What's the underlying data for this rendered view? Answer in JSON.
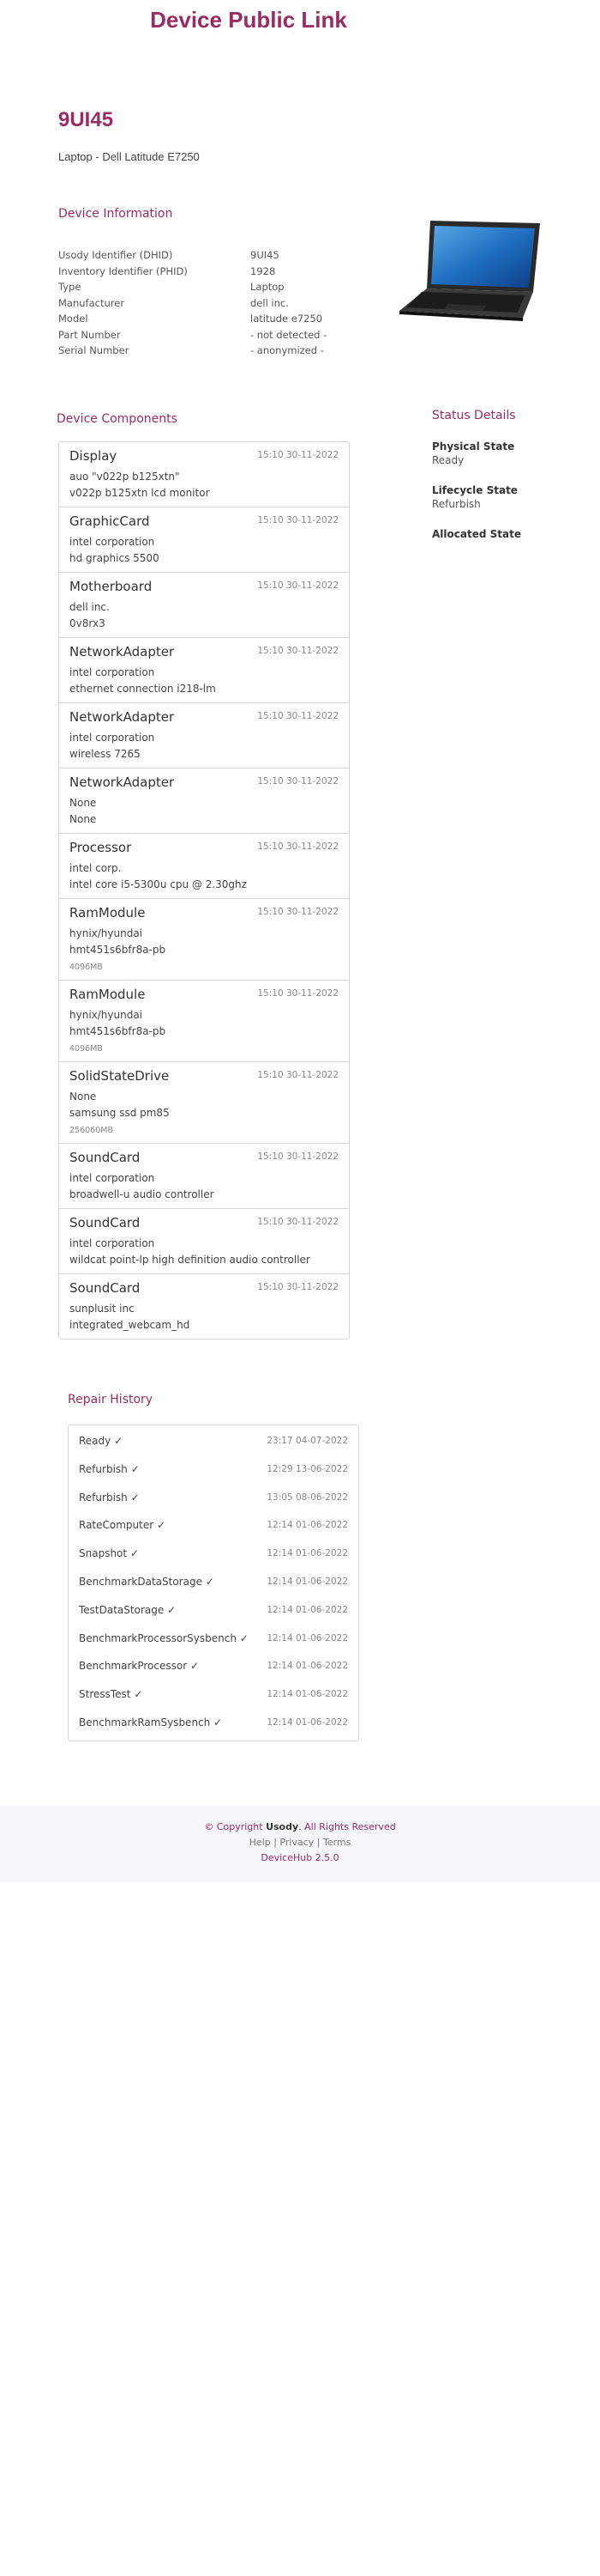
{
  "header": {
    "title": "Device Public Link"
  },
  "device": {
    "code": "9UI45",
    "subtitle": "Laptop - Dell Latitude E7250"
  },
  "info": {
    "heading": "Device Information",
    "rows": [
      {
        "label": "Usody Identifier (DHID)",
        "value": "9UI45"
      },
      {
        "label": "Inventory Identifier (PHID)",
        "value": "1928"
      },
      {
        "label": "Type",
        "value": "Laptop"
      },
      {
        "label": "Manufacturer",
        "value": "dell inc."
      },
      {
        "label": "Model",
        "value": "latitude e7250"
      },
      {
        "label": "Part Number",
        "value": "- not detected -"
      },
      {
        "label": "Serial Number",
        "value": "- anonymized -"
      }
    ]
  },
  "components": {
    "heading": "Device Components",
    "items": [
      {
        "type": "Display",
        "time": "15:10 30-11-2022",
        "line1": "auo \"v022p b125xtn\"",
        "line2": "v022p b125xtn lcd monitor",
        "size": ""
      },
      {
        "type": "GraphicCard",
        "time": "15:10 30-11-2022",
        "line1": "intel corporation",
        "line2": "hd graphics 5500",
        "size": ""
      },
      {
        "type": "Motherboard",
        "time": "15:10 30-11-2022",
        "line1": "dell inc.",
        "line2": "0v8rx3",
        "size": ""
      },
      {
        "type": "NetworkAdapter",
        "time": "15:10 30-11-2022",
        "line1": "intel corporation",
        "line2": "ethernet connection i218-lm",
        "size": ""
      },
      {
        "type": "NetworkAdapter",
        "time": "15:10 30-11-2022",
        "line1": "intel corporation",
        "line2": "wireless 7265",
        "size": ""
      },
      {
        "type": "NetworkAdapter",
        "time": "15:10 30-11-2022",
        "line1": "None",
        "line2": "None",
        "size": ""
      },
      {
        "type": "Processor",
        "time": "15:10 30-11-2022",
        "line1": "intel corp.",
        "line2": "intel core i5-5300u cpu @ 2.30ghz",
        "size": ""
      },
      {
        "type": "RamModule",
        "time": "15:10 30-11-2022",
        "line1": "hynix/hyundai",
        "line2": "hmt451s6bfr8a-pb",
        "size": "4096MB"
      },
      {
        "type": "RamModule",
        "time": "15:10 30-11-2022",
        "line1": "hynix/hyundai",
        "line2": "hmt451s6bfr8a-pb",
        "size": "4096MB"
      },
      {
        "type": "SolidStateDrive",
        "time": "15:10 30-11-2022",
        "line1": "None",
        "line2": "samsung ssd pm85",
        "size": "256060MB"
      },
      {
        "type": "SoundCard",
        "time": "15:10 30-11-2022",
        "line1": "intel corporation",
        "line2": "broadwell-u audio controller",
        "size": ""
      },
      {
        "type": "SoundCard",
        "time": "15:10 30-11-2022",
        "line1": "intel corporation",
        "line2": "wildcat point-lp high definition audio controller",
        "size": ""
      },
      {
        "type": "SoundCard",
        "time": "15:10 30-11-2022",
        "line1": "sunplusit inc",
        "line2": "integrated_webcam_hd",
        "size": ""
      }
    ]
  },
  "status": {
    "heading": "Status Details",
    "physical_label": "Physical State",
    "physical_value": "Ready",
    "lifecycle_label": "Lifecycle State",
    "lifecycle_value": "Refurbish",
    "allocated_label": "Allocated State"
  },
  "repair": {
    "heading": "Repair History",
    "items": [
      {
        "action": "Ready ✓",
        "time": "23:17 04-07-2022"
      },
      {
        "action": "Refurbish ✓",
        "time": "12:29 13-06-2022"
      },
      {
        "action": "Refurbish ✓",
        "time": "13:05 08-06-2022"
      },
      {
        "action": "RateComputer ✓",
        "time": "12:14 01-06-2022"
      },
      {
        "action": "Snapshot ✓",
        "time": "12:14 01-06-2022"
      },
      {
        "action": "BenchmarkDataStorage ✓",
        "time": "12:14 01-06-2022"
      },
      {
        "action": "TestDataStorage ✓",
        "time": "12:14 01-06-2022"
      },
      {
        "action": "BenchmarkProcessorSysbench ✓",
        "time": "12:14 01-06-2022"
      },
      {
        "action": "BenchmarkProcessor ✓",
        "time": "12:14 01-06-2022"
      },
      {
        "action": "StressTest ✓",
        "time": "12:14 01-06-2022"
      },
      {
        "action": "BenchmarkRamSysbench ✓",
        "time": "12:14 01-06-2022"
      }
    ]
  },
  "footer": {
    "copyright_prefix": "© Copyright ",
    "brand": "Usody",
    "copyright_suffix": ". All Rights Reserved",
    "help": "Help",
    "privacy": "Privacy",
    "terms": "Terms",
    "separator": " | ",
    "version": "DeviceHub 2.5.0"
  },
  "colors": {
    "accent": "#9a2c63",
    "footer_bg": "#f5f7fc",
    "border": "#d6d6d6"
  }
}
